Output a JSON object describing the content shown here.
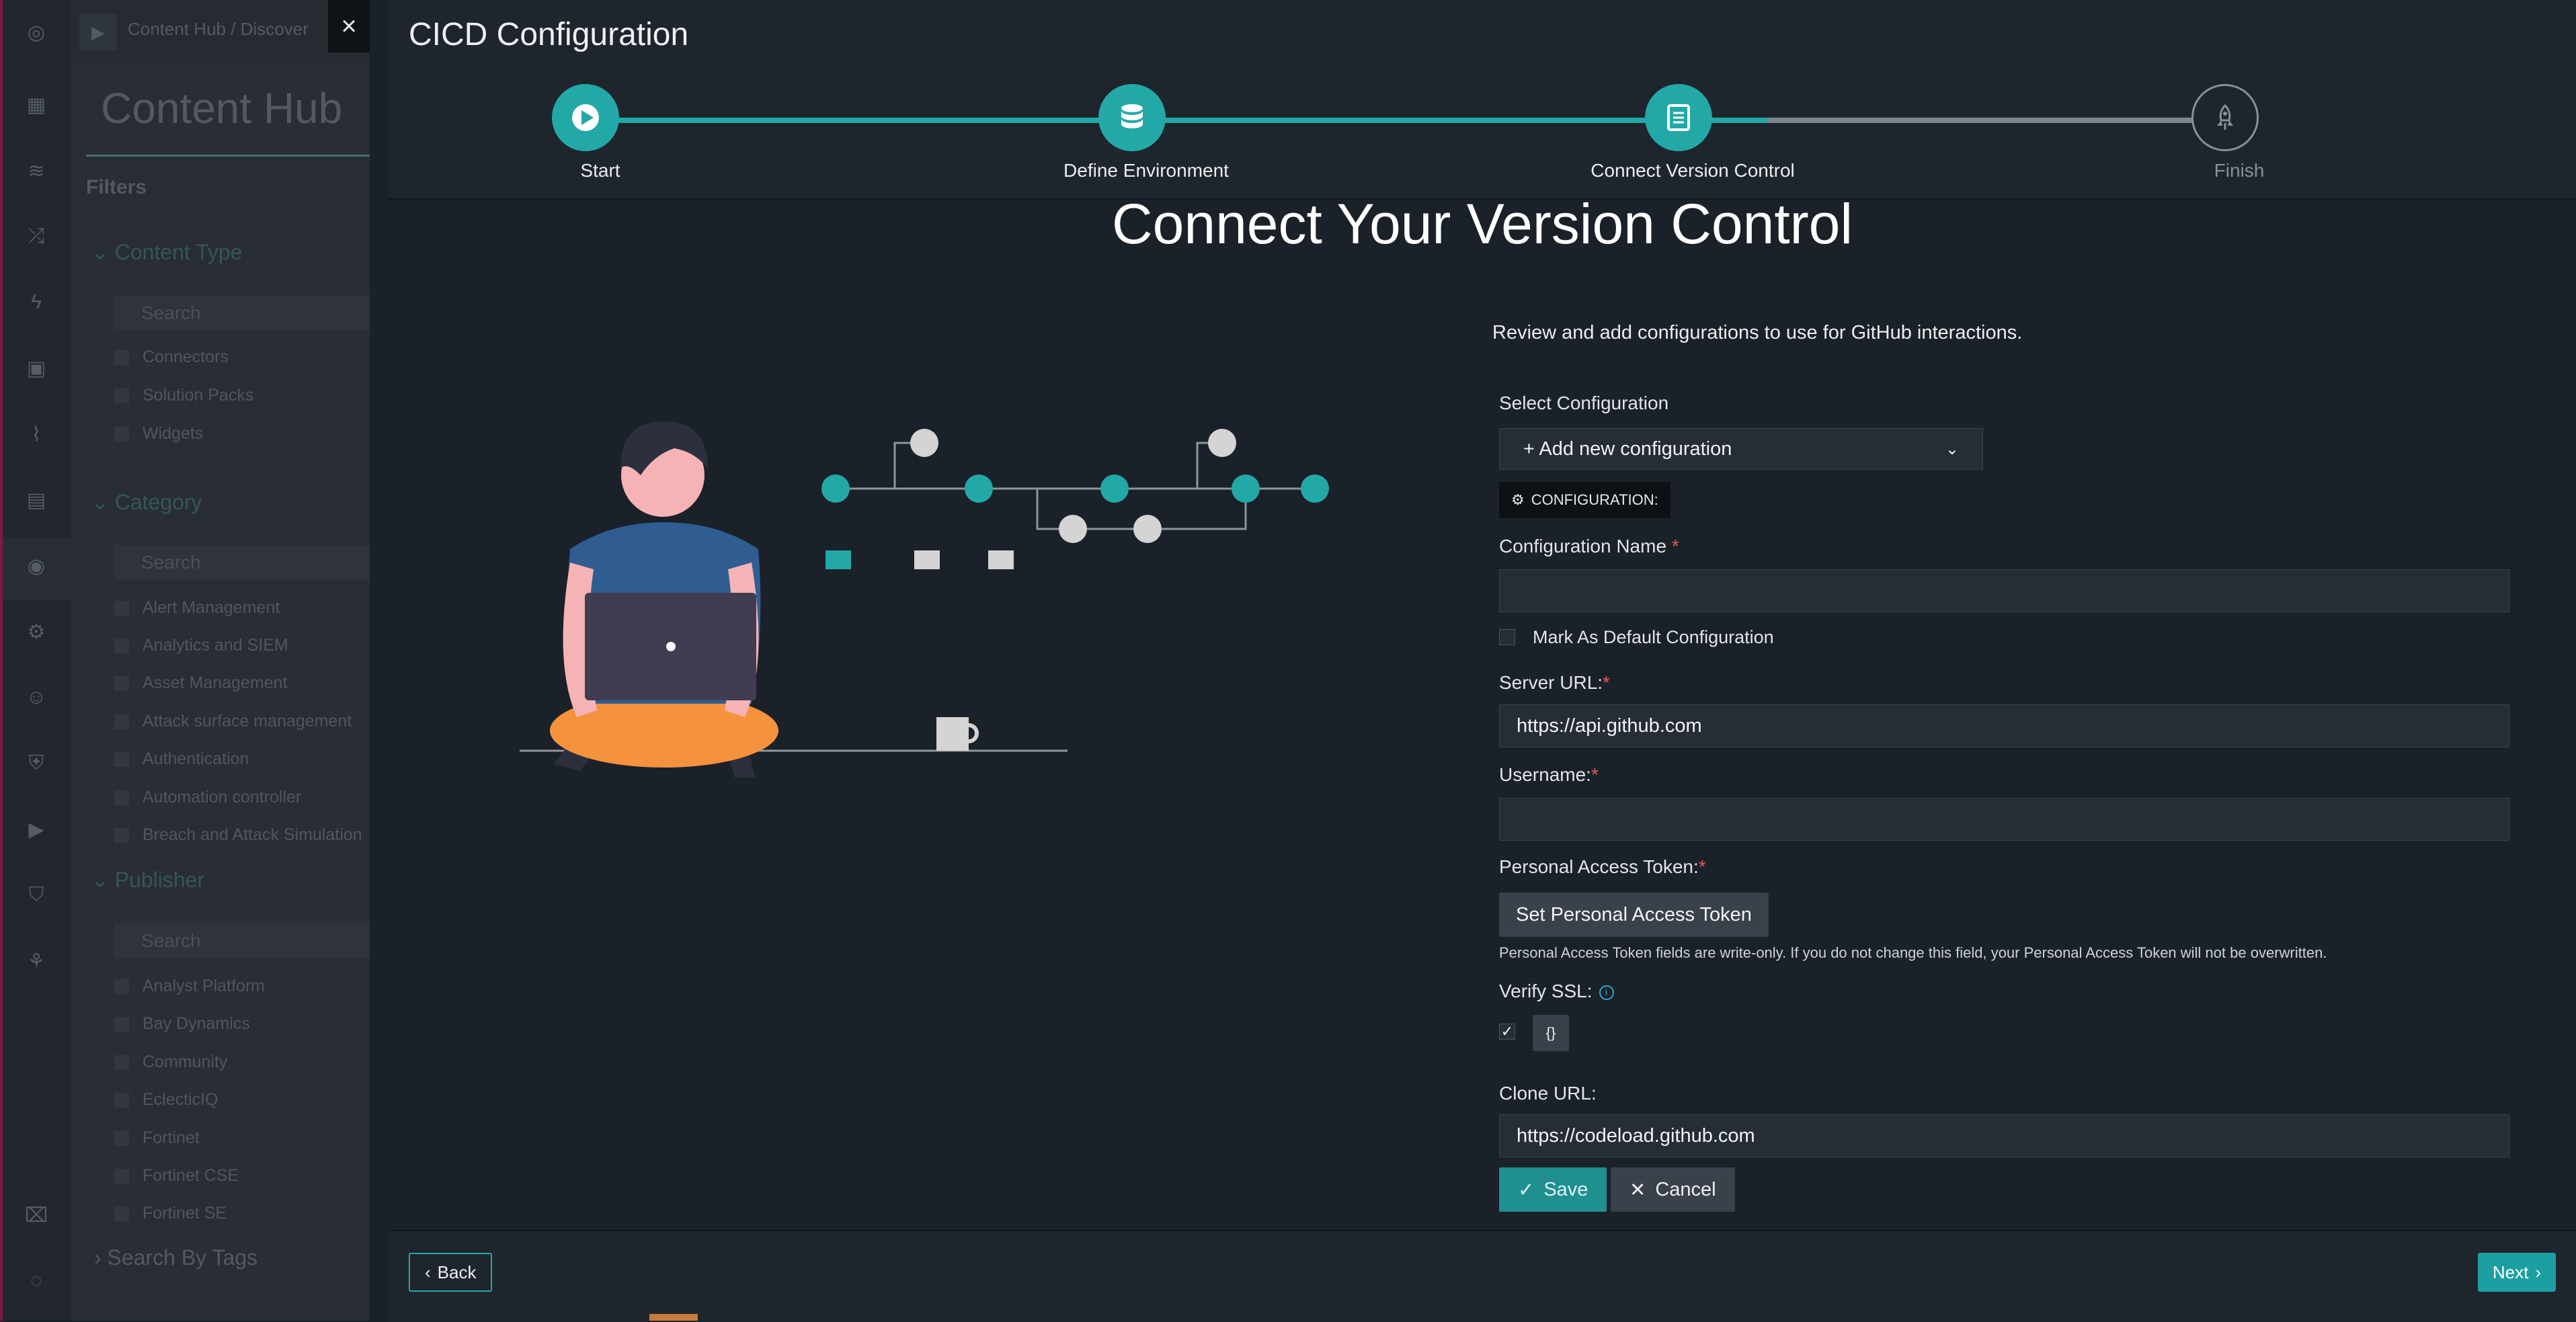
{
  "background": {
    "breadcrumb": "Content Hub  /  Discover",
    "title": "Content Hub",
    "filters_label": "Filters",
    "sections": {
      "content_type": "Content Type",
      "category": "Category",
      "publisher": "Publisher"
    },
    "search_placeholder": "Search",
    "content_type_items": [
      "Connectors",
      "Solution Packs",
      "Widgets"
    ],
    "category_items": [
      "Alert Management",
      "Analytics and SIEM",
      "Asset Management",
      "Attack surface management",
      "Authentication",
      "Automation controller",
      "Breach and Attack Simulation"
    ],
    "publisher_items": [
      "Analyst Platform",
      "Bay Dynamics",
      "Community",
      "EclecticIQ",
      "Fortinet",
      "Fortinet CSE",
      "Fortinet SE"
    ],
    "search_by_tags": "Search By Tags",
    "close_glyph": "×"
  },
  "modal": {
    "title": "CICD Configuration",
    "steps": [
      {
        "label": "Start",
        "state": "done",
        "icon": "play-icon"
      },
      {
        "label": "Define Environment",
        "state": "done",
        "icon": "database-icon"
      },
      {
        "label": "Connect Version Control",
        "state": "active",
        "icon": "document-icon"
      },
      {
        "label": "Finish",
        "state": "pending",
        "icon": "rocket-icon"
      }
    ],
    "heading": "Connect Your Version Control",
    "intro": "Review and add configurations to use for GitHub interactions.",
    "form": {
      "select_configuration_label": "Select Configuration",
      "select_configuration_value": "+ Add new configuration",
      "configuration_badge": "CONFIGURATION:",
      "configuration_name_label": "Configuration Name",
      "configuration_name_value": "",
      "default_config_label": "Mark As Default Configuration",
      "server_url_label": "Server URL:",
      "server_url_value": "https://api.github.com",
      "username_label": "Username:",
      "username_value": "",
      "pat_label": "Personal Access Token:",
      "pat_button": "Set Personal Access Token",
      "pat_help": "Personal Access Token fields are write-only. If you do not change this field, your Personal Access Token will not be overwritten.",
      "verify_ssl_label": "Verify SSL:",
      "verify_ssl_checked": true,
      "json_button": "{}",
      "clone_url_label": "Clone URL:",
      "clone_url_value": "https://codeload.github.com",
      "save_label": "Save",
      "cancel_label": "Cancel",
      "required_mark": "*"
    },
    "footer": {
      "back_label": "Back",
      "next_label": "Next"
    }
  },
  "colors": {
    "accent": "#23a8a8",
    "background": "#1b2129",
    "panel": "#1e252d",
    "pending": "#8a9097",
    "required": "#e05a5a"
  }
}
